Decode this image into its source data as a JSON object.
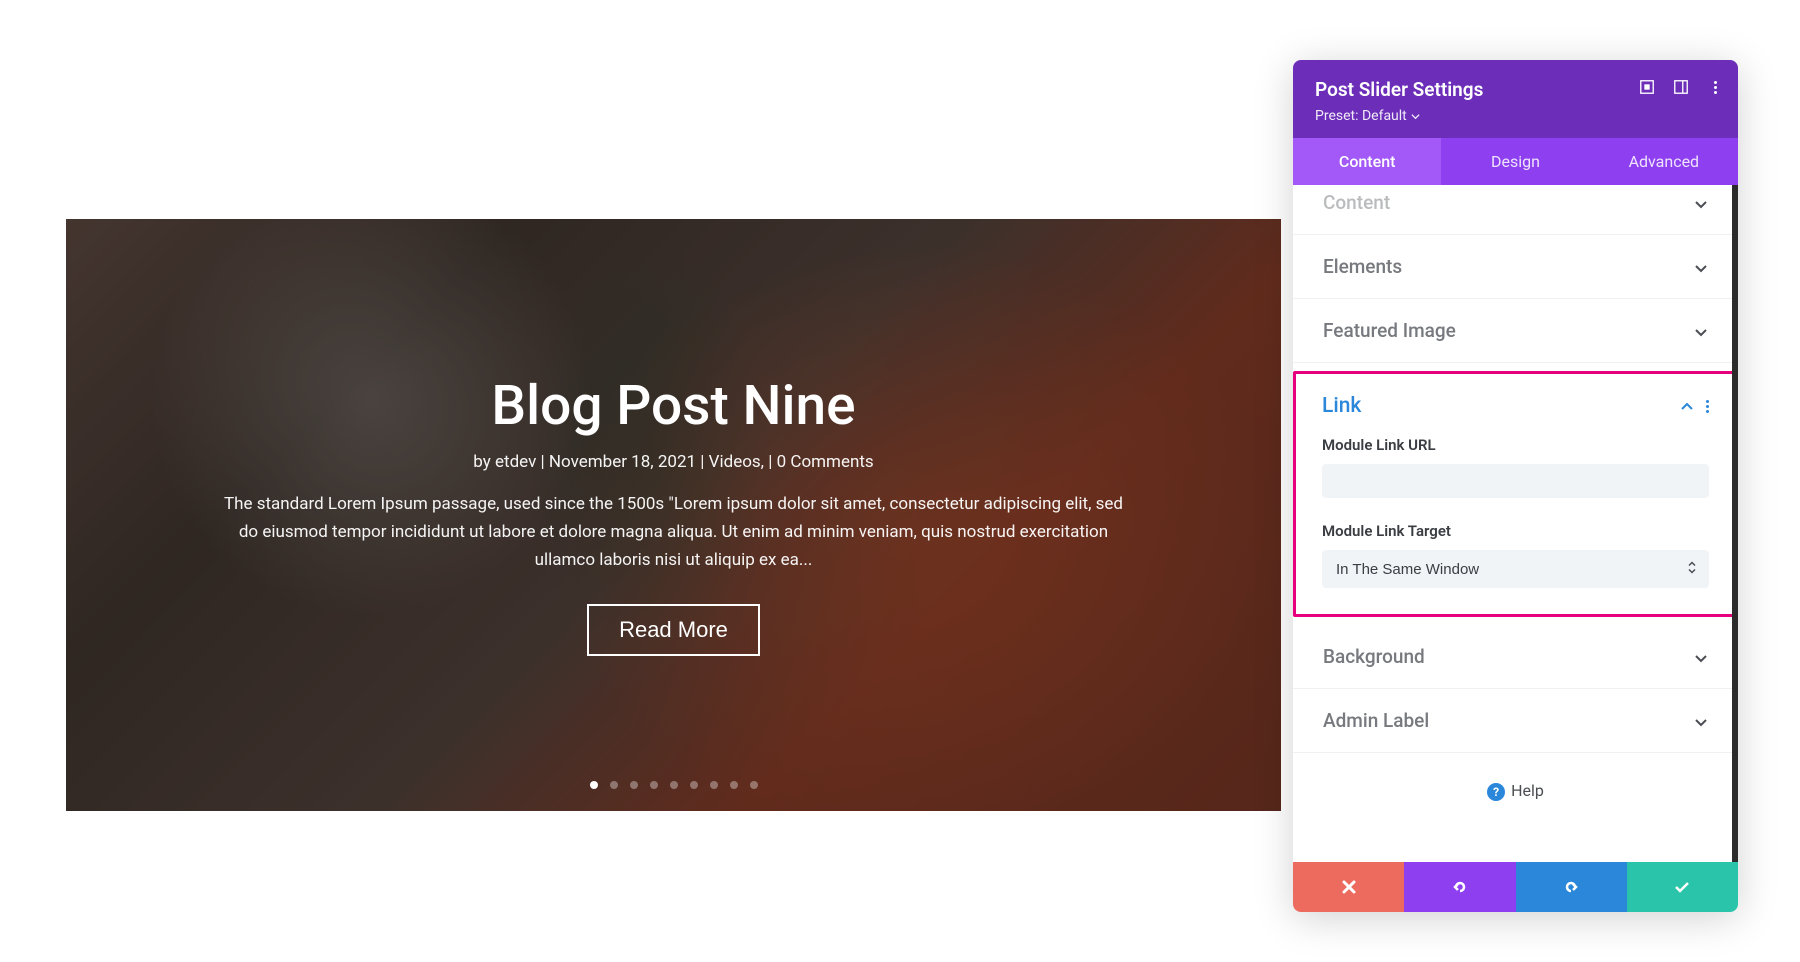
{
  "slider": {
    "title": "Blog Post Nine",
    "meta": "by etdev | November 18, 2021 | Videos, | 0 Comments",
    "description": "The standard Lorem Ipsum passage, used since the 1500s \"Lorem ipsum dolor sit amet, consectetur adipiscing elit, sed do eiusmod tempor incididunt ut labore et dolore magna aliqua. Ut enim ad minim veniam, quis nostrud exercitation ullamco laboris nisi ut aliquip ex ea...",
    "button_label": "Read More",
    "dots_count": 9,
    "active_dot": 0
  },
  "panel": {
    "title": "Post Slider Settings",
    "preset_label": "Preset: Default",
    "tabs": {
      "content": "Content",
      "design": "Design",
      "advanced": "Advanced"
    },
    "sections": {
      "content_cut": "Content",
      "elements": "Elements",
      "featured_image": "Featured Image",
      "link": "Link",
      "background": "Background",
      "admin_label": "Admin Label"
    },
    "link": {
      "url_label": "Module Link URL",
      "url_value": "",
      "target_label": "Module Link Target",
      "target_value": "In The Same Window"
    },
    "help_label": "Help"
  }
}
